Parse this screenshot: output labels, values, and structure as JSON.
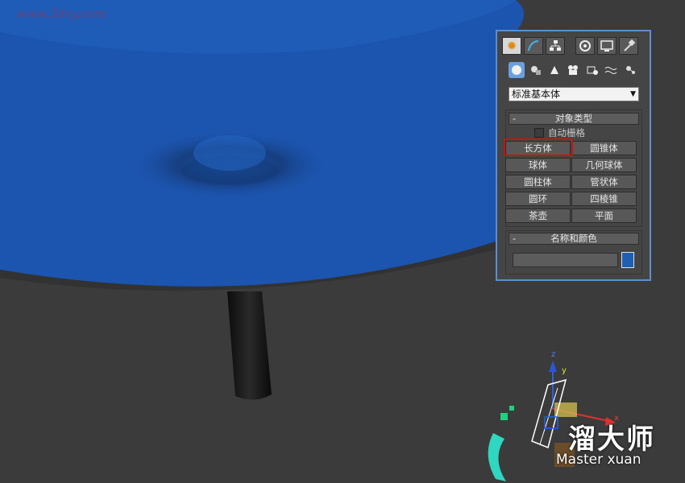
{
  "watermark": {
    "url_text": "www.3dxy.com",
    "tile_text": "www.3dxy.com"
  },
  "panel": {
    "tabs": [
      {
        "name": "create-tab",
        "icon": "create-icon"
      },
      {
        "name": "modify-tab",
        "icon": "modify-icon"
      },
      {
        "name": "hierarchy-tab",
        "icon": "hierarchy-icon"
      },
      {
        "name": "motion-tab",
        "icon": "motion-icon"
      },
      {
        "name": "display-tab",
        "icon": "display-icon"
      },
      {
        "name": "utilities-tab",
        "icon": "hammer-icon"
      }
    ],
    "category_dropdown": "标准基本体",
    "object_type": {
      "title": "对象类型",
      "collapse": "-",
      "autogrid_label": "自动栅格",
      "buttons": [
        "长方体",
        "圆锥体",
        "球体",
        "几何球体",
        "圆柱体",
        "管状体",
        "圆环",
        "四棱锥",
        "茶壶",
        "平面"
      ]
    },
    "name_color": {
      "title": "名称和颜色",
      "collapse": "-",
      "color": "#1f5fb0"
    }
  },
  "gizmo": {
    "z": "z",
    "y": "y",
    "x": "x"
  },
  "logo": {
    "cn": "溜大师",
    "en": "Master xuan"
  },
  "colors": {
    "object_blue": "#1c55b0",
    "viewport_bg": "#3a3a3a",
    "panel_border": "#5a8fd0",
    "highlight": "#d01010"
  }
}
